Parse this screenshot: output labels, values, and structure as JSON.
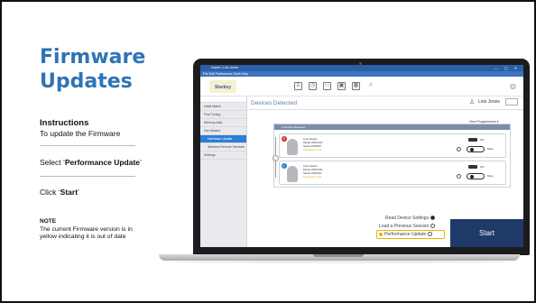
{
  "slide": {
    "title_line1": "Firmware",
    "title_line2": "Updates",
    "instructions_heading": "Instructions",
    "instructions_text": "To update the Firmware",
    "step1_prefix": "Select ‘",
    "step1_bold": "Performance Update",
    "step1_suffix": "’",
    "step2_prefix": "Click ‘",
    "step2_bold": "Start",
    "step2_suffix": "’",
    "note_heading": "NOTE",
    "note_text": "The current Firmware version is in yellow indicating it is out of date"
  },
  "app": {
    "window_title": "Inspire   |   Lois Jones",
    "menu": "File   Edit   Preferences   Tools   Help",
    "logo": "Starkey",
    "screen_title": "Devices Detected",
    "patient_name": "Lois Jones",
    "view_programmers": "View Programmers ▾",
    "panel_header": "2 Devices Detected",
    "sidebar": [
      "Initial Match",
      "Fine Tuning",
      "Memory Aids",
      "Get Started",
      "Hardware Update",
      "Wireless Remote Services",
      "Settings"
    ],
    "devices": [
      {
        "side": "R",
        "name": "Livio Series",
        "model": "Model 2400 RIC",
        "serial": "Serial 1234567",
        "firmware": "Firmware 1.0.2",
        "switch_label": "ON",
        "toggle_label": "Mute"
      },
      {
        "side": "L",
        "name": "Livio Series",
        "model": "Model 2400 RIC",
        "serial": "Serial 7654321",
        "firmware": "Firmware 1.0.2",
        "switch_label": "ON",
        "toggle_label": "Mute"
      }
    ],
    "options": {
      "read": "Read Device Settings",
      "load": "Load a Previous Session",
      "performance": "Performance Update"
    },
    "start_label": "Start"
  },
  "colors": {
    "title_blue": "#2e74b5",
    "start_bg": "#1f3a68",
    "highlight_yellow": "#f0b400",
    "sidebar_active": "#2b7fd4"
  }
}
